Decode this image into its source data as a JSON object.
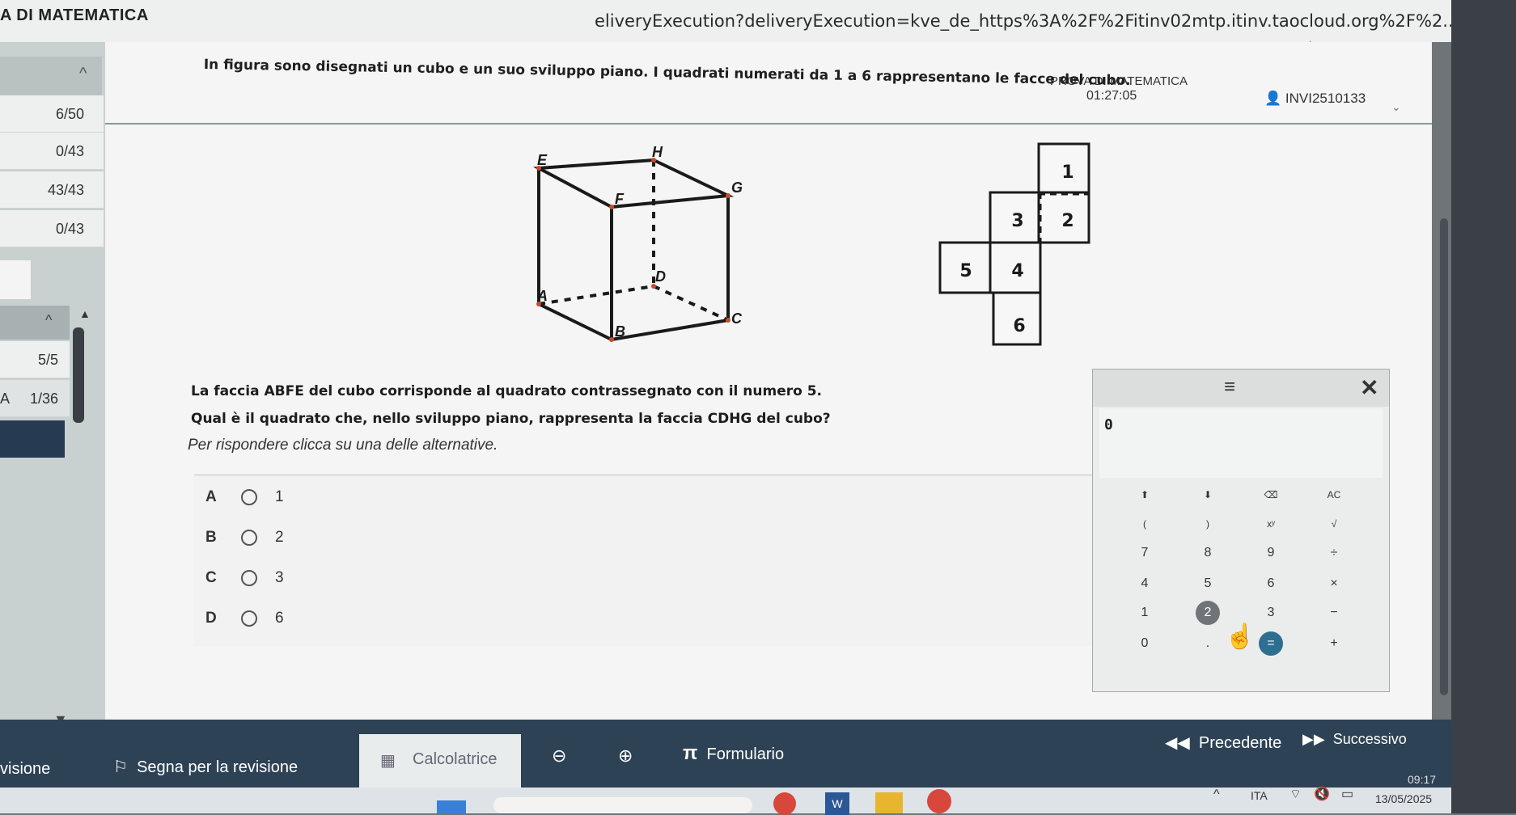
{
  "app": {
    "title": "A DI MATEMATICA",
    "url": "eliveryExecution?deliveryExecution=kve_de_https%3A%2F%2Fitinv02mtp.itinv.taocloud.org%2F%2...",
    "prova_label": "PROVA DI MATEMATICA",
    "timer": "01:27:05",
    "user_id": "INVI2510133"
  },
  "sidebar": {
    "items": [
      "6/50",
      "0/43",
      "43/43",
      "0/43",
      "5/5",
      "1/36"
    ],
    "active_prefix": "A"
  },
  "question": {
    "intro": "In figura sono disegnati un cubo e un suo sviluppo piano. I quadrati numerati da 1 a 6 rappresentano le facce del cubo.",
    "line1": "La faccia ABFE del cubo corrisponde al quadrato contrassegnato con il numero 5.",
    "line2": "Qual è il quadrato che, nello sviluppo piano, rappresenta la faccia CDHG del cubo?",
    "instruction": "Per rispondere clicca su una delle alternative."
  },
  "cube": {
    "labels": [
      "E",
      "H",
      "G",
      "F",
      "D",
      "A",
      "C",
      "B"
    ]
  },
  "net": {
    "faces": [
      "1",
      "3",
      "2",
      "5",
      "4",
      "6"
    ]
  },
  "options": [
    {
      "letter": "A",
      "value": "1"
    },
    {
      "letter": "B",
      "value": "2"
    },
    {
      "letter": "C",
      "value": "3"
    },
    {
      "letter": "D",
      "value": "6"
    }
  ],
  "calculator": {
    "display": "0",
    "menu_icon": "hamburger-icon",
    "keys": [
      [
        "⬆",
        "⬇",
        "⌫",
        "AC"
      ],
      [
        "(",
        ")",
        "xʸ",
        "√"
      ],
      [
        "7",
        "8",
        "9",
        "÷"
      ],
      [
        "4",
        "5",
        "6",
        "×"
      ],
      [
        "1",
        "2",
        "3",
        "−"
      ],
      [
        "0",
        ".",
        "=",
        "+"
      ]
    ]
  },
  "toolbar": {
    "revisione": "visione",
    "segna": "Segna per la revisione",
    "calcolatrice": "Calcolatrice",
    "formulario": "Formulario",
    "precedente": "Precedente",
    "successivo": "Successivo"
  },
  "tray": {
    "lang": "ITA",
    "time": "09:17",
    "date": "13/05/2025"
  },
  "colors": {
    "toolbar_bg": "#2e4256",
    "sidebar_active": "#263a52",
    "calc_equal": "#2e6e90"
  }
}
